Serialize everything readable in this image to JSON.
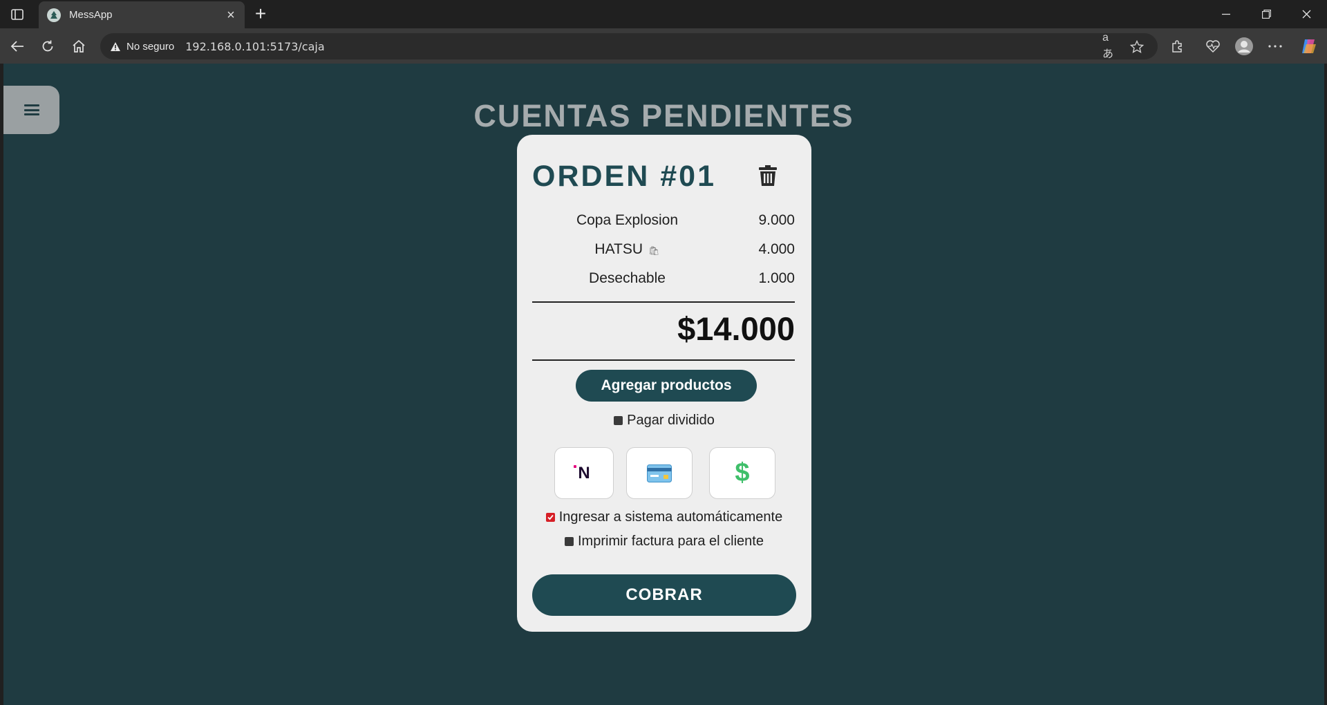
{
  "browser": {
    "tab_title": "MessApp",
    "security_label": "No seguro",
    "url": "192.168.0.101:5173/caja"
  },
  "page": {
    "title": "CUENTAS PENDIENTES"
  },
  "order": {
    "title": "ORDEN #01",
    "items": [
      {
        "name": "Copa Explosion",
        "price": "9.000",
        "tag": ""
      },
      {
        "name": "HATSU",
        "price": "4.000",
        "tag": "🛍"
      },
      {
        "name": "Desechable",
        "price": "1.000",
        "tag": ""
      }
    ],
    "total": "$14.000",
    "add_products_label": "Agregar productos",
    "split_payment_label": "Pagar dividido",
    "split_payment_checked": false,
    "payment_methods": [
      {
        "name": "nequi",
        "label": "N"
      },
      {
        "name": "card",
        "label": ""
      },
      {
        "name": "cash",
        "label": "$"
      }
    ],
    "auto_register_label": "Ingresar a sistema automáticamente",
    "auto_register_checked": true,
    "print_invoice_label": "Imprimir factura para el cliente",
    "print_invoice_checked": false,
    "charge_label": "COBRAR"
  },
  "colors": {
    "page_bg": "#1f3b41",
    "accent": "#1f4a52",
    "card_bg": "#eeeeee",
    "checkbox_on": "#d61f26"
  }
}
